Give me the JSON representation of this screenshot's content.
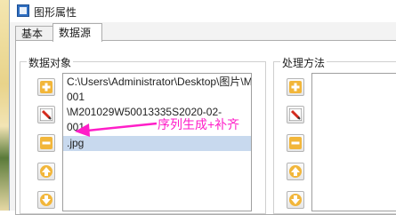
{
  "window": {
    "title": "图形属性"
  },
  "tabs": [
    {
      "label": "基本",
      "active": false
    },
    {
      "label": "数据源",
      "active": true
    }
  ],
  "data_objects": {
    "label": "数据对象",
    "items": [
      "C:\\Users\\Administrator\\Desktop\\图片\\M",
      "001",
      "\\M201029W50013335S2020-02-",
      "001",
      ".jpg"
    ],
    "selected_index": 4
  },
  "processing": {
    "label": "处理方法",
    "items": []
  },
  "annotation": {
    "text": "序列生成+补齐"
  },
  "colors": {
    "annotation": "#ff1ec8",
    "selection": "#c8d9ee",
    "accent": "#2f6fc2"
  },
  "icons": [
    "add-icon",
    "edit-icon",
    "remove-icon",
    "move-up-icon",
    "move-down-icon"
  ]
}
